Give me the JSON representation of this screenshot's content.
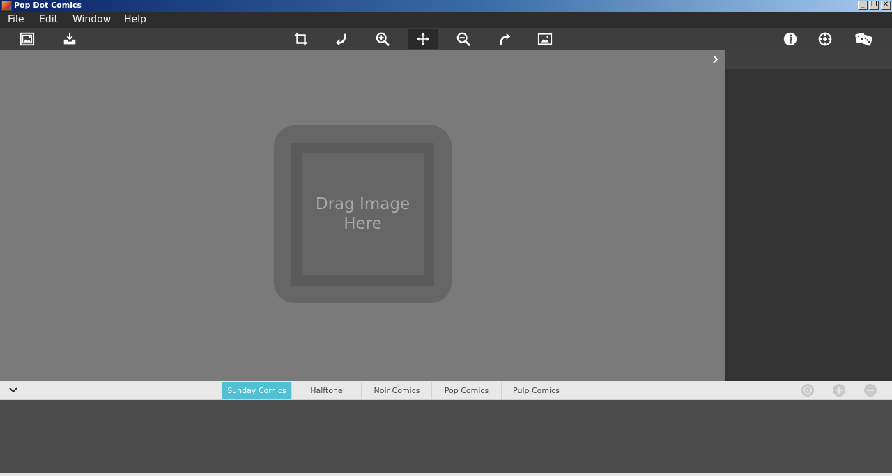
{
  "window": {
    "title": "Pop Dot Comics",
    "buttons": [
      "_",
      "❐",
      "✕"
    ]
  },
  "menu": {
    "items": [
      "File",
      "Edit",
      "Window",
      "Help"
    ]
  },
  "toolbar": {
    "left": [
      "open-image-icon",
      "save-icon"
    ],
    "center": [
      "crop-icon",
      "rotate-left-icon",
      "zoom-in-icon",
      "pan-move-icon",
      "zoom-out-icon",
      "rotate-right-icon",
      "fit-image-icon"
    ],
    "active_tool": "pan-move-icon",
    "right": [
      "info-icon",
      "settings-icon",
      "randomize-dice-icon"
    ]
  },
  "canvas": {
    "drop_text_line1": "Drag Image",
    "drop_text_line2": "Here"
  },
  "tabs": {
    "items": [
      "Sunday Comics",
      "Halftone",
      "Noir Comics",
      "Pop Comics",
      "Pulp Comics"
    ],
    "active": "Sunday Comics",
    "accent": "#4fc1d2"
  },
  "preset_actions": [
    "preset-options-icon",
    "add-preset-icon",
    "remove-preset-icon"
  ]
}
